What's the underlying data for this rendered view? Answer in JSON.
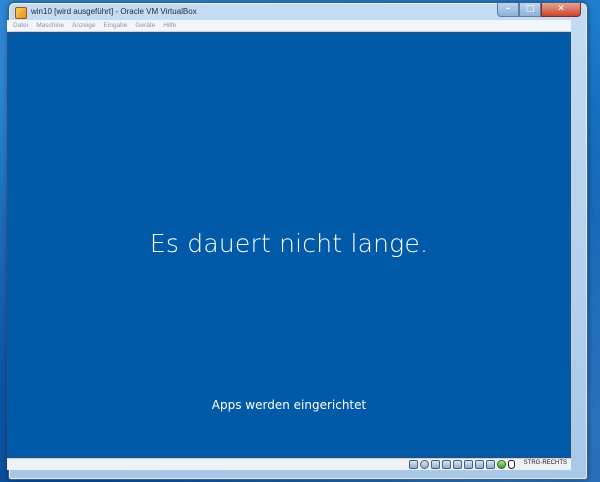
{
  "window": {
    "title": "win10 [wird ausgeführt] - Oracle VM VirtualBox",
    "buttons": {
      "minimize": "–",
      "maximize": "□",
      "close": "✕"
    }
  },
  "menu": [
    {
      "label": "Datei"
    },
    {
      "label": "Maschine"
    },
    {
      "label": "Anzeige"
    },
    {
      "label": "Eingabe"
    },
    {
      "label": "Geräte"
    },
    {
      "label": "Hilfe"
    }
  ],
  "screen": {
    "headline": "Es dauert nicht lange.",
    "subtitle": "Apps werden eingerichtet"
  },
  "statusbar": {
    "icons": [
      "hard-disk-icon",
      "optical-drive-icon",
      "audio-icon",
      "network-icon",
      "usb-icon",
      "shared-folders-icon",
      "display-icon",
      "video-capture-icon",
      "virtualization-icon",
      "mouse-integration-icon"
    ],
    "host_key": "STRG-RECHTS"
  },
  "colors": {
    "vm_background": "#005aa7",
    "text": "#ffffff"
  }
}
